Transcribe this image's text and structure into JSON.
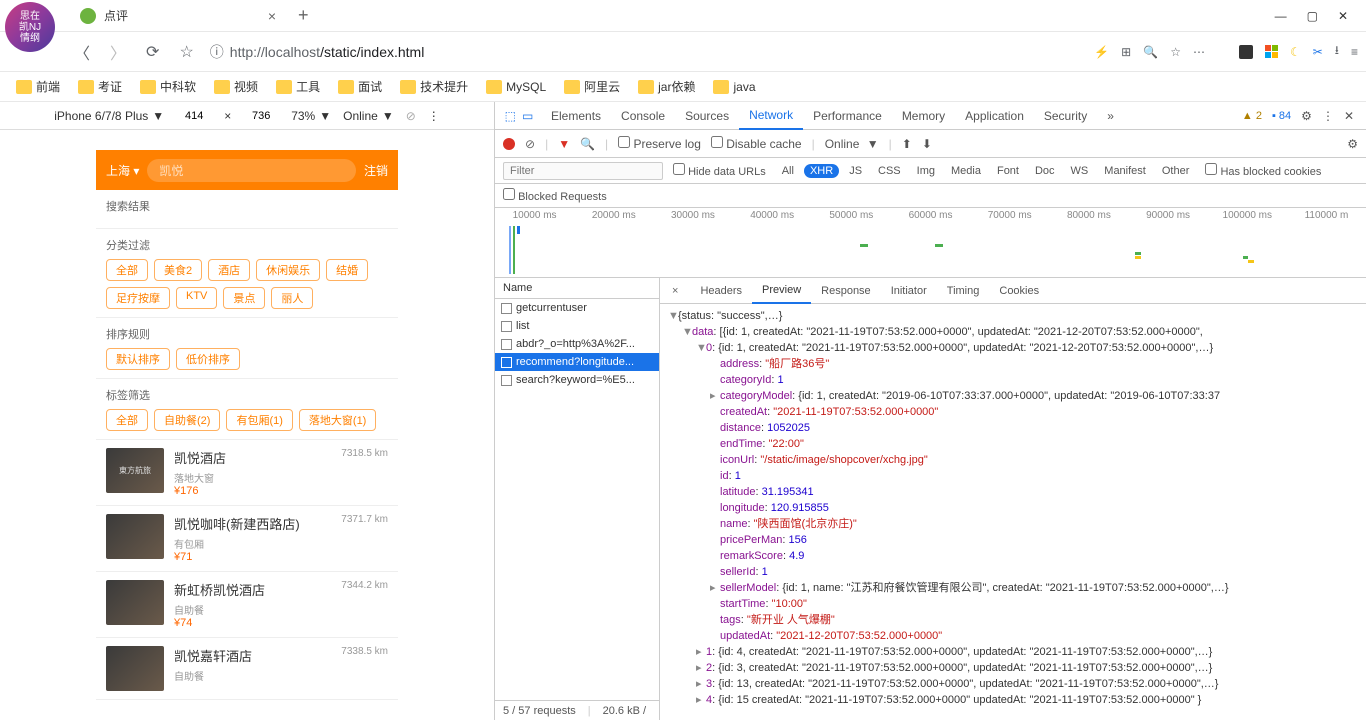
{
  "window": {
    "title": "点评",
    "min": "—",
    "max": "▢",
    "close": "✕",
    "newtab": "+"
  },
  "address": {
    "scheme_host": "http://localhost",
    "path": "/static/index.html"
  },
  "bookmarks": [
    "前端",
    "考证",
    "中科软",
    "视频",
    "工具",
    "面试",
    "技术提升",
    "MySQL",
    "阿里云",
    "jar依赖",
    "java"
  ],
  "deviceBar": {
    "device": "iPhone 6/7/8 Plus",
    "w": "414",
    "h": "736",
    "zoom": "73%",
    "throttle": "Online"
  },
  "app": {
    "location": "上海",
    "locCaret": "▾",
    "searchValue": "凯悦",
    "publish": "注销",
    "sec_search": "搜索结果",
    "sec_filter": "分类过滤",
    "filters": [
      "全部",
      "美食2",
      "酒店",
      "休闲娱乐",
      "结婚",
      "足疗按摩",
      "KTV",
      "景点",
      "丽人"
    ],
    "sec_sort": "排序规则",
    "sorts": [
      "默认排序",
      "低价排序"
    ],
    "sec_tag": "标签筛选",
    "tags": [
      "全部",
      "自助餐(2)",
      "有包厢(1)",
      "落地大窗(1)"
    ],
    "results": [
      {
        "title": "凯悦酒店",
        "tag": "落地大窗",
        "price": "¥176",
        "dist": "7318.5 km",
        "thumb": "東方航旅"
      },
      {
        "title": "凯悦咖啡(新建西路店)",
        "tag": "有包厢",
        "price": "¥71",
        "dist": "7371.7 km",
        "thumb": ""
      },
      {
        "title": "新虹桥凯悦酒店",
        "tag": "自助餐",
        "price": "¥74",
        "dist": "7344.2 km",
        "thumb": ""
      },
      {
        "title": "凯悦嘉轩酒店",
        "tag": "自助餐",
        "price": "",
        "dist": "7338.5 km",
        "thumb": ""
      }
    ]
  },
  "devtools": {
    "tabs": [
      "Elements",
      "Console",
      "Sources",
      "Network",
      "Performance",
      "Memory",
      "Application",
      "Security"
    ],
    "activeTab": "Network",
    "more": "»",
    "warn": "▲ 2",
    "info": "▪ 84",
    "toolbar": {
      "preserve": "Preserve log",
      "disableCache": "Disable cache",
      "throttle": "Online"
    },
    "filter": {
      "placeholder": "Filter",
      "hideData": "Hide data URLs",
      "types": [
        "All",
        "XHR",
        "JS",
        "CSS",
        "Img",
        "Media",
        "Font",
        "Doc",
        "WS",
        "Manifest",
        "Other"
      ],
      "activeType": "XHR",
      "hasBlocked": "Has blocked cookies",
      "blockedReq": "Blocked Requests"
    },
    "timelineTicks": [
      "10000 ms",
      "20000 ms",
      "30000 ms",
      "40000 ms",
      "50000 ms",
      "60000 ms",
      "70000 ms",
      "80000 ms",
      "90000 ms",
      "100000 ms",
      "110000 m"
    ],
    "requestsHdr": "Name",
    "requests": [
      "getcurrentuser",
      "list",
      "abdr?_o=http%3A%2F...",
      "recommend?longitude...",
      "search?keyword=%E5..."
    ],
    "selectedReq": 3,
    "detailTabs": [
      "Headers",
      "Preview",
      "Response",
      "Initiator",
      "Timing",
      "Cookies"
    ],
    "activeDetail": "Preview",
    "status": {
      "reqs": "5 / 57 requests",
      "size": "20.6 kB /"
    }
  },
  "json": {
    "root": "{status: \"success\",…}",
    "data_hdr": "[{id: 1, createdAt: \"2021-11-19T07:53:52.000+0000\", updatedAt: \"2021-12-20T07:53:52.000+0000\",",
    "idx0": "{id: 1, createdAt: \"2021-11-19T07:53:52.000+0000\", updatedAt: \"2021-12-20T07:53:52.000+0000\",…}",
    "address_k": "address",
    "address_v": "\"船厂路36号\"",
    "categoryId_k": "categoryId",
    "categoryId_v": "1",
    "categoryModel_k": "categoryModel",
    "categoryModel_v": "{id: 1, createdAt: \"2019-06-10T07:33:37.000+0000\", updatedAt: \"2019-06-10T07:33:37",
    "createdAt_k": "createdAt",
    "createdAt_v": "\"2021-11-19T07:53:52.000+0000\"",
    "distance_k": "distance",
    "distance_v": "1052025",
    "endTime_k": "endTime",
    "endTime_v": "\"22:00\"",
    "iconUrl_k": "iconUrl",
    "iconUrl_v": "\"/static/image/shopcover/xchg.jpg\"",
    "id_k": "id",
    "id_v": "1",
    "latitude_k": "latitude",
    "latitude_v": "31.195341",
    "longitude_k": "longitude",
    "longitude_v": "120.915855",
    "name_k": "name",
    "name_v": "\"陕西面馆(北京亦庄)\"",
    "pricePerMan_k": "pricePerMan",
    "pricePerMan_v": "156",
    "remarkScore_k": "remarkScore",
    "remarkScore_v": "4.9",
    "sellerId_k": "sellerId",
    "sellerId_v": "1",
    "sellerModel_k": "sellerModel",
    "sellerModel_v": "{id: 1, name: \"江苏和府餐饮管理有限公司\", createdAt: \"2021-11-19T07:53:52.000+0000\",…}",
    "startTime_k": "startTime",
    "startTime_v": "\"10:00\"",
    "tags_k": "tags",
    "tags_v": "\"新开业 人气爆棚\"",
    "updatedAt_k": "updatedAt",
    "updatedAt_v": "\"2021-12-20T07:53:52.000+0000\"",
    "idx1": "{id: 4, createdAt: \"2021-11-19T07:53:52.000+0000\", updatedAt: \"2021-11-19T07:53:52.000+0000\",…}",
    "idx2": "{id: 3, createdAt: \"2021-11-19T07:53:52.000+0000\", updatedAt: \"2021-11-19T07:53:52.000+0000\",…}",
    "idx3": "{id: 13, createdAt: \"2021-11-19T07:53:52.000+0000\", updatedAt: \"2021-11-19T07:53:52.000+0000\",…}",
    "idx4": "{id: 15  createdAt: \"2021-11-19T07:53:52.000+0000\"  updatedAt: \"2021-11-19T07:53:52.000+0000\" }"
  }
}
